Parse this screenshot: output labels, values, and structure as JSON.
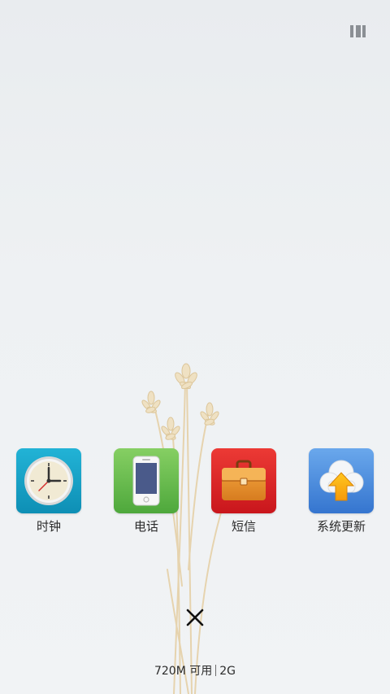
{
  "recents": {
    "apps": [
      {
        "label": "时钟",
        "icon": "clock-icon",
        "color": "#1aa1c4"
      },
      {
        "label": "电话",
        "icon": "phone-icon",
        "color": "#5fb34a"
      },
      {
        "label": "短信",
        "icon": "briefcase-icon",
        "color": "#e0262a"
      },
      {
        "label": "系统更新",
        "icon": "cloud-upload-icon",
        "color": "#3d86d9"
      }
    ],
    "close_icon": "close-icon",
    "grid_icon": "view-grid-icon"
  },
  "memory": {
    "available": "720M 可用",
    "total": "2G"
  }
}
